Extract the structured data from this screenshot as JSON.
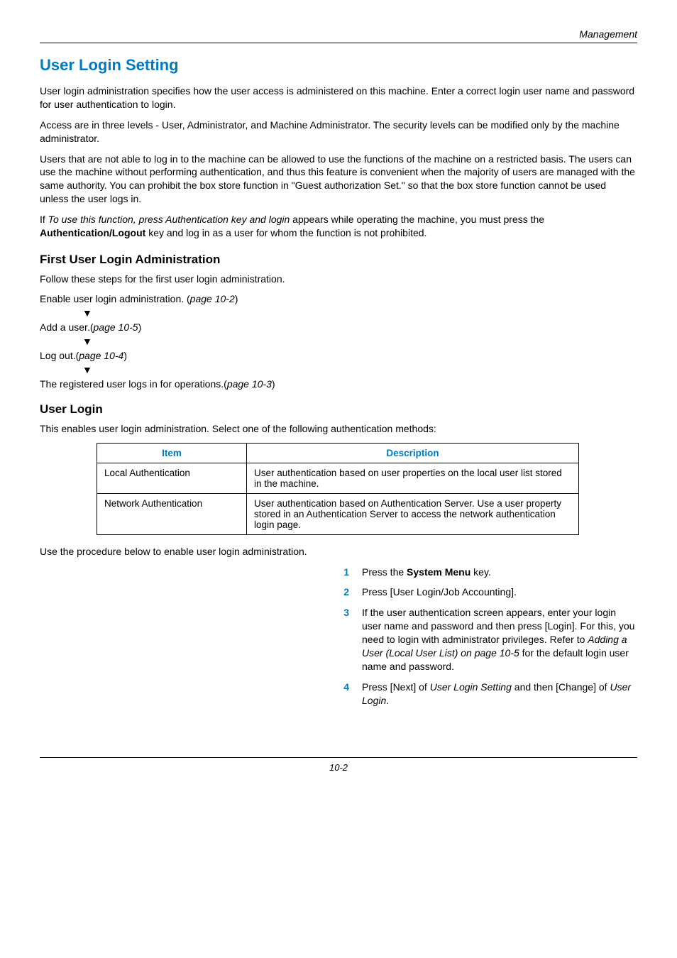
{
  "header": {
    "section": "Management"
  },
  "title": "User Login Setting",
  "paras": {
    "p1": "User login administration specifies how the user access is administered on this machine. Enter a correct login user name and password for user authentication to login.",
    "p2": "Access are in three levels - User, Administrator, and Machine Administrator. The security levels can be modified only by the machine administrator.",
    "p3": "Users that are not able to log in to the machine can be allowed to use the functions of the machine on a restricted basis. The users can use the machine without performing authentication, and thus this feature is convenient when the majority of users are managed with the same authority. You can prohibit the box store function in \"Guest authorization Set.\" so that the box store function cannot be used unless the user logs in.",
    "p4_pre": "If ",
    "p4_ital": "To use this function, press Authentication key and login",
    "p4_mid": " appears while operating the machine, you must press the ",
    "p4_bold": "Authentication/Logout",
    "p4_post": " key and log in as a user for whom the function is not prohibited."
  },
  "first_admin": {
    "heading": "First User Login Administration",
    "intro": "Follow these steps for the first user login administration.",
    "enable_pre": "Enable user login administration. (",
    "enable_ref": "page 10-2",
    "enable_post": ")",
    "add_pre": "Add a user.(",
    "add_ref": "page 10-5",
    "add_post": ")",
    "logout_pre": "Log out.(",
    "logout_ref": "page 10-4",
    "logout_post": ")",
    "reg_pre": "The registered user logs in for operations.(",
    "reg_ref": "page 10-3",
    "reg_post": ")"
  },
  "user_login": {
    "heading": "User Login",
    "intro": "This enables user login administration. Select one of the following authentication methods:"
  },
  "table": {
    "head_item": "Item",
    "head_desc": "Description",
    "rows": [
      {
        "item": "Local Authentication",
        "desc": "User authentication based on user properties on the local user list stored in the machine."
      },
      {
        "item": "Network Authentication",
        "desc": "User authentication based on Authentication Server. Use a user property stored in an Authentication Server to access the network authentication login page."
      }
    ]
  },
  "below_table": "Use the procedure below to enable user login administration.",
  "steps": [
    {
      "num": "1",
      "pre": "Press the ",
      "bold": "System Menu",
      "post": " key."
    },
    {
      "num": "2",
      "text": "Press [User Login/Job Accounting]."
    },
    {
      "num": "3",
      "pre": "If the user authentication screen appears, enter your login user name and password and then press [Login]. For this, you need to login with administrator privileges. Refer to ",
      "ital": "Adding a User (Local User List) on page 10-5",
      "post": " for the default login user name and password."
    },
    {
      "num": "4",
      "pre": "Press [Next] of ",
      "ital": "User Login Setting",
      "mid": " and then [Change] of ",
      "ital2": "User Login",
      "post": "."
    }
  ],
  "footer": {
    "page": "10-2"
  },
  "glyphs": {
    "down": "▼"
  }
}
